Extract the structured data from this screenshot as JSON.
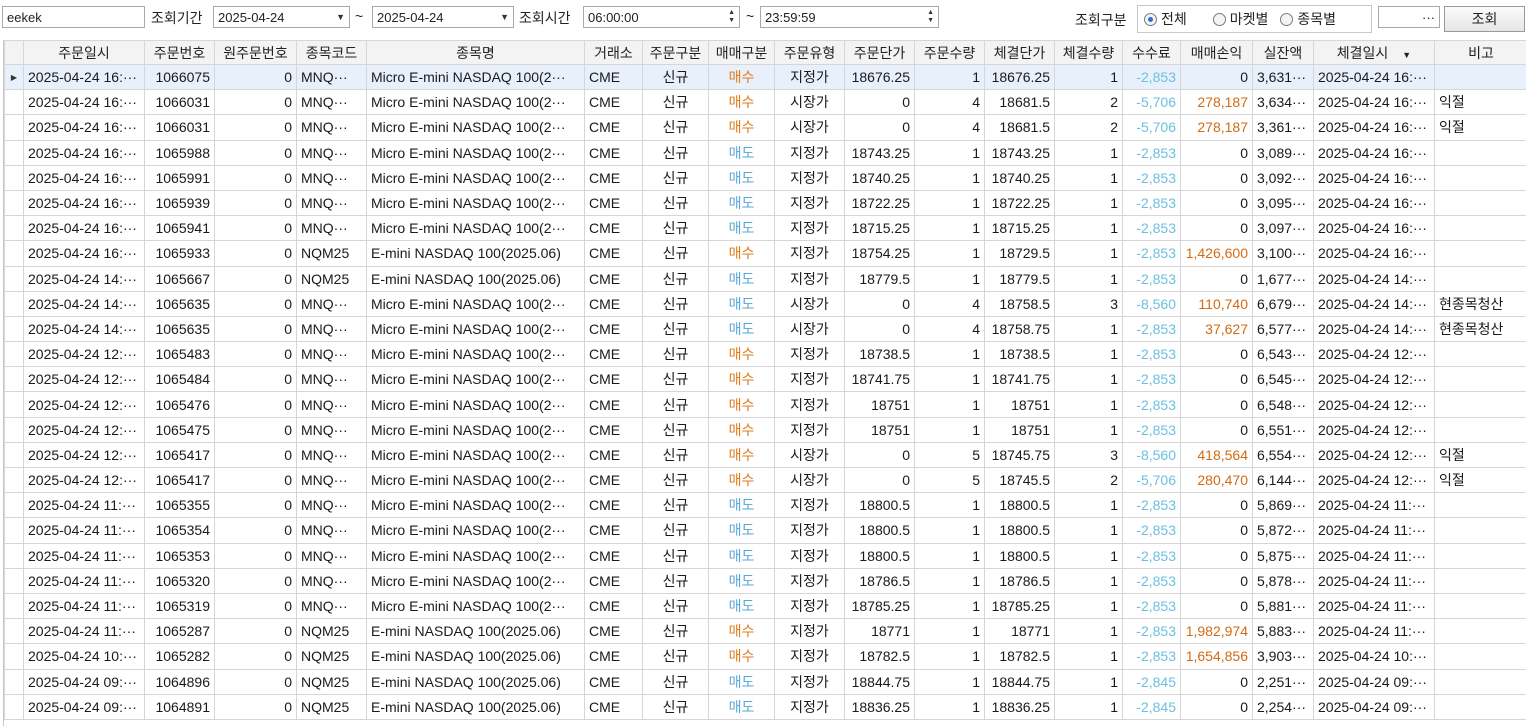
{
  "toolbar": {
    "account": "eekek",
    "period_label": "조회기간",
    "date_from": "2025-04-24",
    "date_to": "2025-04-24",
    "tilde": "~",
    "time_label": "조회시간",
    "time_from": "06:00:00",
    "time_to": "23:59:59",
    "type_label": "조회구분",
    "radios": [
      {
        "label": "전체",
        "checked": true
      },
      {
        "label": "마켓별",
        "checked": false
      },
      {
        "label": "종목별",
        "checked": false
      }
    ],
    "more_button": "···",
    "search_button": "조회"
  },
  "table": {
    "headers": [
      "주문일시",
      "주문번호",
      "원주문번호",
      "종목코드",
      "종목명",
      "거래소",
      "주문구분",
      "매매구분",
      "주문유형",
      "주문단가",
      "주문수량",
      "체결단가",
      "체결수량",
      "수수료",
      "매매손익",
      "실잔액",
      "체결일시",
      "비고"
    ],
    "rows": [
      {
        "d": "2025-04-24 16:···",
        "no": "1066075",
        "orig": "0",
        "code": "MNQ···",
        "name": "Micro E-mini NASDAQ 100(2···",
        "ex": "CME",
        "kind": "신규",
        "side": "매수",
        "type": "지정가",
        "price": "18676.25",
        "qty": "1",
        "fprice": "18676.25",
        "fqty": "1",
        "fee": "-2,853",
        "pl": "0",
        "bal": "3,631···",
        "fdate": "2025-04-24 16:···",
        "note": ""
      },
      {
        "d": "2025-04-24 16:···",
        "no": "1066031",
        "orig": "0",
        "code": "MNQ···",
        "name": "Micro E-mini NASDAQ 100(2···",
        "ex": "CME",
        "kind": "신규",
        "side": "매수",
        "type": "시장가",
        "price": "0",
        "qty": "4",
        "fprice": "18681.5",
        "fqty": "2",
        "fee": "-5,706",
        "pl": "278,187",
        "bal": "3,634···",
        "fdate": "2025-04-24 16:···",
        "note": "익절"
      },
      {
        "d": "2025-04-24 16:···",
        "no": "1066031",
        "orig": "0",
        "code": "MNQ···",
        "name": "Micro E-mini NASDAQ 100(2···",
        "ex": "CME",
        "kind": "신규",
        "side": "매수",
        "type": "시장가",
        "price": "0",
        "qty": "4",
        "fprice": "18681.5",
        "fqty": "2",
        "fee": "-5,706",
        "pl": "278,187",
        "bal": "3,361···",
        "fdate": "2025-04-24 16:···",
        "note": "익절"
      },
      {
        "d": "2025-04-24 16:···",
        "no": "1065988",
        "orig": "0",
        "code": "MNQ···",
        "name": "Micro E-mini NASDAQ 100(2···",
        "ex": "CME",
        "kind": "신규",
        "side": "매도",
        "type": "지정가",
        "price": "18743.25",
        "qty": "1",
        "fprice": "18743.25",
        "fqty": "1",
        "fee": "-2,853",
        "pl": "0",
        "bal": "3,089···",
        "fdate": "2025-04-24 16:···",
        "note": ""
      },
      {
        "d": "2025-04-24 16:···",
        "no": "1065991",
        "orig": "0",
        "code": "MNQ···",
        "name": "Micro E-mini NASDAQ 100(2···",
        "ex": "CME",
        "kind": "신규",
        "side": "매도",
        "type": "지정가",
        "price": "18740.25",
        "qty": "1",
        "fprice": "18740.25",
        "fqty": "1",
        "fee": "-2,853",
        "pl": "0",
        "bal": "3,092···",
        "fdate": "2025-04-24 16:···",
        "note": ""
      },
      {
        "d": "2025-04-24 16:···",
        "no": "1065939",
        "orig": "0",
        "code": "MNQ···",
        "name": "Micro E-mini NASDAQ 100(2···",
        "ex": "CME",
        "kind": "신규",
        "side": "매도",
        "type": "지정가",
        "price": "18722.25",
        "qty": "1",
        "fprice": "18722.25",
        "fqty": "1",
        "fee": "-2,853",
        "pl": "0",
        "bal": "3,095···",
        "fdate": "2025-04-24 16:···",
        "note": ""
      },
      {
        "d": "2025-04-24 16:···",
        "no": "1065941",
        "orig": "0",
        "code": "MNQ···",
        "name": "Micro E-mini NASDAQ 100(2···",
        "ex": "CME",
        "kind": "신규",
        "side": "매도",
        "type": "지정가",
        "price": "18715.25",
        "qty": "1",
        "fprice": "18715.25",
        "fqty": "1",
        "fee": "-2,853",
        "pl": "0",
        "bal": "3,097···",
        "fdate": "2025-04-24 16:···",
        "note": ""
      },
      {
        "d": "2025-04-24 16:···",
        "no": "1065933",
        "orig": "0",
        "code": "NQM25",
        "name": "E-mini NASDAQ 100(2025.06)",
        "ex": "CME",
        "kind": "신규",
        "side": "매수",
        "type": "지정가",
        "price": "18754.25",
        "qty": "1",
        "fprice": "18729.5",
        "fqty": "1",
        "fee": "-2,853",
        "pl": "1,426,600",
        "bal": "3,100···",
        "fdate": "2025-04-24 16:···",
        "note": ""
      },
      {
        "d": "2025-04-24 14:···",
        "no": "1065667",
        "orig": "0",
        "code": "NQM25",
        "name": "E-mini NASDAQ 100(2025.06)",
        "ex": "CME",
        "kind": "신규",
        "side": "매도",
        "type": "지정가",
        "price": "18779.5",
        "qty": "1",
        "fprice": "18779.5",
        "fqty": "1",
        "fee": "-2,853",
        "pl": "0",
        "bal": "1,677···",
        "fdate": "2025-04-24 14:···",
        "note": ""
      },
      {
        "d": "2025-04-24 14:···",
        "no": "1065635",
        "orig": "0",
        "code": "MNQ···",
        "name": "Micro E-mini NASDAQ 100(2···",
        "ex": "CME",
        "kind": "신규",
        "side": "매도",
        "type": "시장가",
        "price": "0",
        "qty": "4",
        "fprice": "18758.5",
        "fqty": "3",
        "fee": "-8,560",
        "pl": "110,740",
        "bal": "6,679···",
        "fdate": "2025-04-24 14:···",
        "note": "현종목청산"
      },
      {
        "d": "2025-04-24 14:···",
        "no": "1065635",
        "orig": "0",
        "code": "MNQ···",
        "name": "Micro E-mini NASDAQ 100(2···",
        "ex": "CME",
        "kind": "신규",
        "side": "매도",
        "type": "시장가",
        "price": "0",
        "qty": "4",
        "fprice": "18758.75",
        "fqty": "1",
        "fee": "-2,853",
        "pl": "37,627",
        "bal": "6,577···",
        "fdate": "2025-04-24 14:···",
        "note": "현종목청산"
      },
      {
        "d": "2025-04-24 12:···",
        "no": "1065483",
        "orig": "0",
        "code": "MNQ···",
        "name": "Micro E-mini NASDAQ 100(2···",
        "ex": "CME",
        "kind": "신규",
        "side": "매수",
        "type": "지정가",
        "price": "18738.5",
        "qty": "1",
        "fprice": "18738.5",
        "fqty": "1",
        "fee": "-2,853",
        "pl": "0",
        "bal": "6,543···",
        "fdate": "2025-04-24 12:···",
        "note": ""
      },
      {
        "d": "2025-04-24 12:···",
        "no": "1065484",
        "orig": "0",
        "code": "MNQ···",
        "name": "Micro E-mini NASDAQ 100(2···",
        "ex": "CME",
        "kind": "신규",
        "side": "매수",
        "type": "지정가",
        "price": "18741.75",
        "qty": "1",
        "fprice": "18741.75",
        "fqty": "1",
        "fee": "-2,853",
        "pl": "0",
        "bal": "6,545···",
        "fdate": "2025-04-24 12:···",
        "note": ""
      },
      {
        "d": "2025-04-24 12:···",
        "no": "1065476",
        "orig": "0",
        "code": "MNQ···",
        "name": "Micro E-mini NASDAQ 100(2···",
        "ex": "CME",
        "kind": "신규",
        "side": "매수",
        "type": "지정가",
        "price": "18751",
        "qty": "1",
        "fprice": "18751",
        "fqty": "1",
        "fee": "-2,853",
        "pl": "0",
        "bal": "6,548···",
        "fdate": "2025-04-24 12:···",
        "note": ""
      },
      {
        "d": "2025-04-24 12:···",
        "no": "1065475",
        "orig": "0",
        "code": "MNQ···",
        "name": "Micro E-mini NASDAQ 100(2···",
        "ex": "CME",
        "kind": "신규",
        "side": "매수",
        "type": "지정가",
        "price": "18751",
        "qty": "1",
        "fprice": "18751",
        "fqty": "1",
        "fee": "-2,853",
        "pl": "0",
        "bal": "6,551···",
        "fdate": "2025-04-24 12:···",
        "note": ""
      },
      {
        "d": "2025-04-24 12:···",
        "no": "1065417",
        "orig": "0",
        "code": "MNQ···",
        "name": "Micro E-mini NASDAQ 100(2···",
        "ex": "CME",
        "kind": "신규",
        "side": "매수",
        "type": "시장가",
        "price": "0",
        "qty": "5",
        "fprice": "18745.75",
        "fqty": "3",
        "fee": "-8,560",
        "pl": "418,564",
        "bal": "6,554···",
        "fdate": "2025-04-24 12:···",
        "note": "익절"
      },
      {
        "d": "2025-04-24 12:···",
        "no": "1065417",
        "orig": "0",
        "code": "MNQ···",
        "name": "Micro E-mini NASDAQ 100(2···",
        "ex": "CME",
        "kind": "신규",
        "side": "매수",
        "type": "시장가",
        "price": "0",
        "qty": "5",
        "fprice": "18745.5",
        "fqty": "2",
        "fee": "-5,706",
        "pl": "280,470",
        "bal": "6,144···",
        "fdate": "2025-04-24 12:···",
        "note": "익절"
      },
      {
        "d": "2025-04-24 11:···",
        "no": "1065355",
        "orig": "0",
        "code": "MNQ···",
        "name": "Micro E-mini NASDAQ 100(2···",
        "ex": "CME",
        "kind": "신규",
        "side": "매도",
        "type": "지정가",
        "price": "18800.5",
        "qty": "1",
        "fprice": "18800.5",
        "fqty": "1",
        "fee": "-2,853",
        "pl": "0",
        "bal": "5,869···",
        "fdate": "2025-04-24 11:···",
        "note": ""
      },
      {
        "d": "2025-04-24 11:···",
        "no": "1065354",
        "orig": "0",
        "code": "MNQ···",
        "name": "Micro E-mini NASDAQ 100(2···",
        "ex": "CME",
        "kind": "신규",
        "side": "매도",
        "type": "지정가",
        "price": "18800.5",
        "qty": "1",
        "fprice": "18800.5",
        "fqty": "1",
        "fee": "-2,853",
        "pl": "0",
        "bal": "5,872···",
        "fdate": "2025-04-24 11:···",
        "note": ""
      },
      {
        "d": "2025-04-24 11:···",
        "no": "1065353",
        "orig": "0",
        "code": "MNQ···",
        "name": "Micro E-mini NASDAQ 100(2···",
        "ex": "CME",
        "kind": "신규",
        "side": "매도",
        "type": "지정가",
        "price": "18800.5",
        "qty": "1",
        "fprice": "18800.5",
        "fqty": "1",
        "fee": "-2,853",
        "pl": "0",
        "bal": "5,875···",
        "fdate": "2025-04-24 11:···",
        "note": ""
      },
      {
        "d": "2025-04-24 11:···",
        "no": "1065320",
        "orig": "0",
        "code": "MNQ···",
        "name": "Micro E-mini NASDAQ 100(2···",
        "ex": "CME",
        "kind": "신규",
        "side": "매도",
        "type": "지정가",
        "price": "18786.5",
        "qty": "1",
        "fprice": "18786.5",
        "fqty": "1",
        "fee": "-2,853",
        "pl": "0",
        "bal": "5,878···",
        "fdate": "2025-04-24 11:···",
        "note": ""
      },
      {
        "d": "2025-04-24 11:···",
        "no": "1065319",
        "orig": "0",
        "code": "MNQ···",
        "name": "Micro E-mini NASDAQ 100(2···",
        "ex": "CME",
        "kind": "신규",
        "side": "매도",
        "type": "지정가",
        "price": "18785.25",
        "qty": "1",
        "fprice": "18785.25",
        "fqty": "1",
        "fee": "-2,853",
        "pl": "0",
        "bal": "5,881···",
        "fdate": "2025-04-24 11:···",
        "note": ""
      },
      {
        "d": "2025-04-24 11:···",
        "no": "1065287",
        "orig": "0",
        "code": "NQM25",
        "name": "E-mini NASDAQ 100(2025.06)",
        "ex": "CME",
        "kind": "신규",
        "side": "매수",
        "type": "지정가",
        "price": "18771",
        "qty": "1",
        "fprice": "18771",
        "fqty": "1",
        "fee": "-2,853",
        "pl": "1,982,974",
        "bal": "5,883···",
        "fdate": "2025-04-24 11:···",
        "note": ""
      },
      {
        "d": "2025-04-24 10:···",
        "no": "1065282",
        "orig": "0",
        "code": "NQM25",
        "name": "E-mini NASDAQ 100(2025.06)",
        "ex": "CME",
        "kind": "신규",
        "side": "매수",
        "type": "지정가",
        "price": "18782.5",
        "qty": "1",
        "fprice": "18782.5",
        "fqty": "1",
        "fee": "-2,853",
        "pl": "1,654,856",
        "bal": "3,903···",
        "fdate": "2025-04-24 10:···",
        "note": ""
      },
      {
        "d": "2025-04-24 09:···",
        "no": "1064896",
        "orig": "0",
        "code": "NQM25",
        "name": "E-mini NASDAQ 100(2025.06)",
        "ex": "CME",
        "kind": "신규",
        "side": "매도",
        "type": "지정가",
        "price": "18844.75",
        "qty": "1",
        "fprice": "18844.75",
        "fqty": "1",
        "fee": "-2,845",
        "pl": "0",
        "bal": "2,251···",
        "fdate": "2025-04-24 09:···",
        "note": ""
      },
      {
        "d": "2025-04-24 09:···",
        "no": "1064891",
        "orig": "0",
        "code": "NQM25",
        "name": "E-mini NASDAQ 100(2025.06)",
        "ex": "CME",
        "kind": "신규",
        "side": "매도",
        "type": "지정가",
        "price": "18836.25",
        "qty": "1",
        "fprice": "18836.25",
        "fqty": "1",
        "fee": "-2,845",
        "pl": "0",
        "bal": "2,254···",
        "fdate": "2025-04-24 09:···",
        "note": ""
      }
    ]
  },
  "colors": {
    "buy": "#e07b1a",
    "sell": "#5aa7d6",
    "fee": "#6dbfe0",
    "profit": "#d16b14",
    "selected_row": "#e8f0fb"
  }
}
